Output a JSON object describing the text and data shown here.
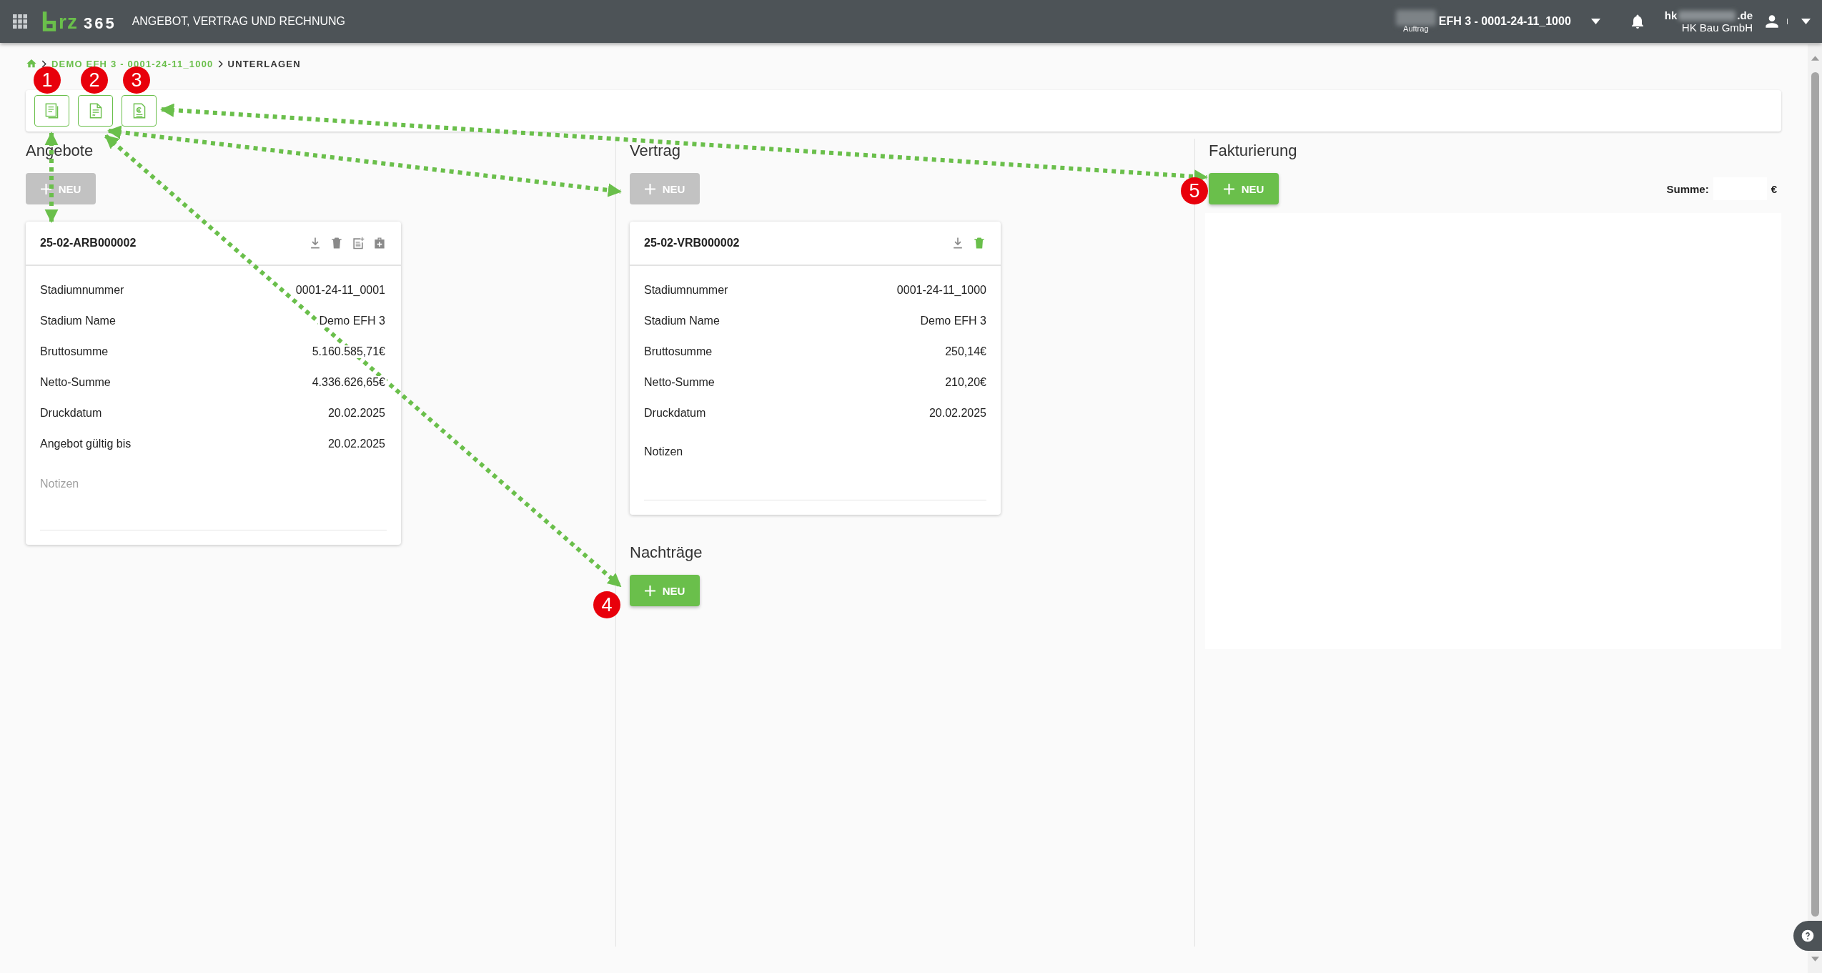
{
  "app_bar": {
    "logo": {
      "mark": "rz",
      "number": "365"
    },
    "title": "ANGEBOT, VERTRAG UND RECHNUNG",
    "order": {
      "name": "EFH 3 - 0001-24-11_1000",
      "caption": "Auftrag"
    },
    "user": {
      "email_start": "hk",
      "email_end": ".de",
      "company": "HK Bau GmbH"
    }
  },
  "breadcrumb": [
    {
      "label": "DEMO EFH 3 - 0001-24-11_1000",
      "link": true
    },
    {
      "label": "UNTERLAGEN",
      "link": false
    }
  ],
  "toolbar": [
    {
      "kind": "offer"
    },
    {
      "kind": "contract"
    },
    {
      "kind": "invoice"
    }
  ],
  "offers": {
    "title": "Angebote",
    "new_button": {
      "label": "NEU",
      "disabled": true
    },
    "cards": [
      {
        "number": "25-02-ARB000002",
        "actions": [
          {
            "kind": "download",
            "highlighted": false
          },
          {
            "kind": "delete",
            "highlighted": false
          },
          {
            "kind": "document",
            "highlighted": false
          },
          {
            "kind": "briefcase",
            "highlighted": false
          }
        ],
        "fields": [
          {
            "label": "Stadiumnummer",
            "value": "0001-24-11_0001"
          },
          {
            "label": "Stadium Name",
            "value": "Demo EFH 3"
          },
          {
            "label": "Bruttosumme",
            "value": "5.160.585,71€"
          },
          {
            "label": "Netto-Summe",
            "value": "4.336.626,65€"
          },
          {
            "label": "Druckdatum",
            "value": "20.02.2025"
          },
          {
            "label": "Angebot gültig bis",
            "value": "20.02.2025"
          }
        ],
        "notes": {
          "kind": "placeholder",
          "placeholder": "Notizen"
        }
      }
    ]
  },
  "contract": {
    "title": "Vertrag",
    "new_button": {
      "label": "NEU",
      "disabled": true
    },
    "cards": [
      {
        "number": "25-02-VRB000002",
        "actions": [
          {
            "kind": "download",
            "highlighted": false
          },
          {
            "kind": "delete",
            "highlighted": true
          }
        ],
        "fields": [
          {
            "label": "Stadiumnummer",
            "value": "0001-24-11_1000"
          },
          {
            "label": "Stadium Name",
            "value": "Demo EFH 3"
          },
          {
            "label": "Bruttosumme",
            "value": "250,14€"
          },
          {
            "label": "Netto-Summe",
            "value": "210,20€"
          },
          {
            "label": "Druckdatum",
            "value": "20.02.2025"
          }
        ],
        "notes": {
          "kind": "label",
          "text": "Notizen"
        }
      }
    ],
    "supplements": {
      "title": "Nachträge",
      "new_button": {
        "label": "NEU",
        "disabled": false
      }
    }
  },
  "billing": {
    "title": "Fakturierung",
    "new_button": {
      "label": "NEU",
      "disabled": false
    },
    "sum": {
      "label": "Summe:",
      "currency": "€"
    }
  },
  "annotations": [
    {
      "label": "1"
    },
    {
      "label": "2"
    },
    {
      "label": "3"
    },
    {
      "label": "4"
    },
    {
      "label": "5"
    }
  ]
}
